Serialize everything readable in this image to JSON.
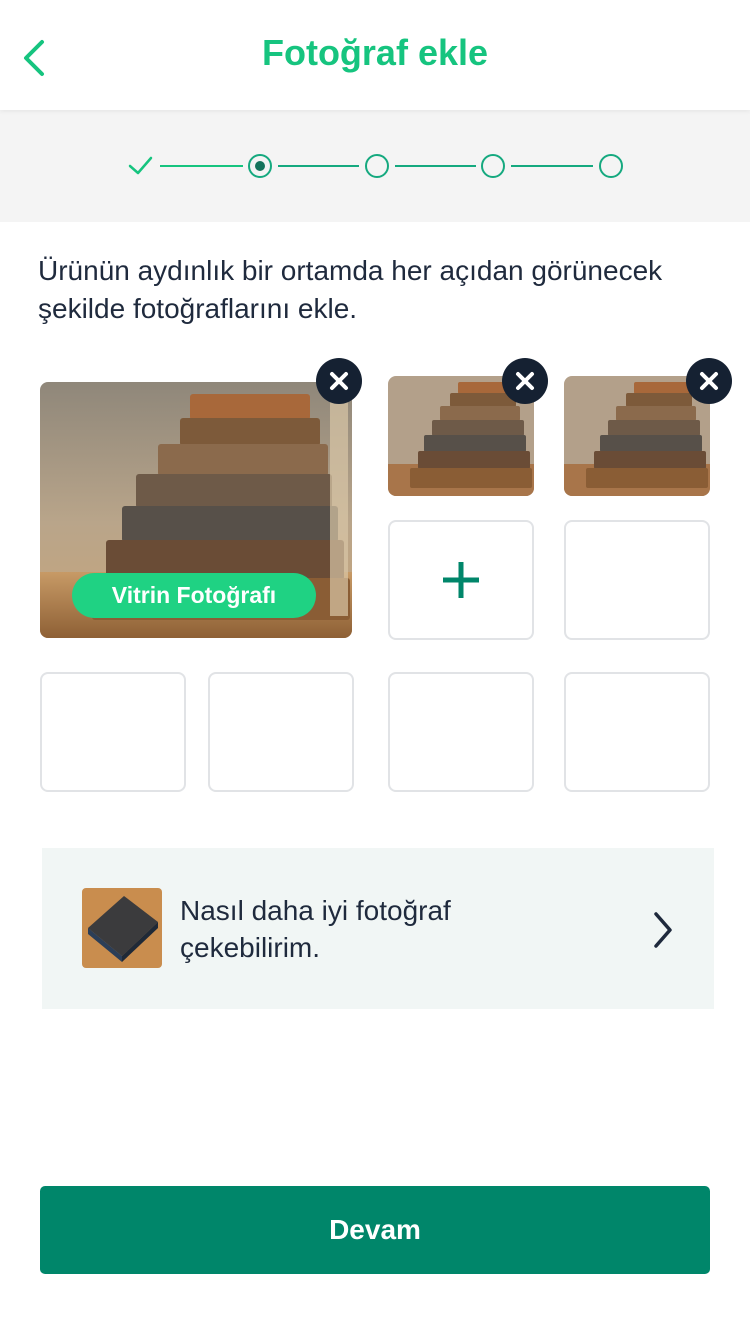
{
  "header": {
    "title": "Fotoğraf ekle",
    "back_icon": "chevron-left-icon"
  },
  "stepper": {
    "steps": [
      "completed",
      "current",
      "pending",
      "pending",
      "pending"
    ],
    "current_step": 2,
    "total_steps": 5
  },
  "instruction": "Ürünün aydınlık bir ortamda her açıdan görünecek şekilde fotoğraflarını ekle.",
  "photos": {
    "showcase_label": "Vitrin Fotoğrafı",
    "uploaded_count": 3,
    "empty_slot_count": 6,
    "add_icon": "plus-icon",
    "remove_icon": "close-icon"
  },
  "tips": {
    "text": "Nasıl daha iyi fotoğraf çekebilirim.",
    "chevron_icon": "chevron-right-icon"
  },
  "continue_button": "Devam",
  "colors": {
    "brand_green": "#16c47f",
    "button_green": "#00866a",
    "badge_green": "#1fd283",
    "dark_navy": "#152132"
  }
}
